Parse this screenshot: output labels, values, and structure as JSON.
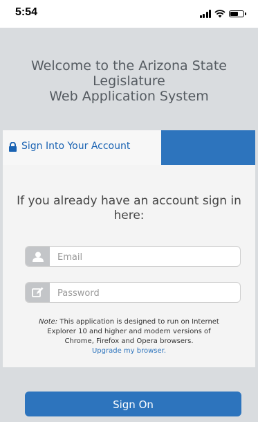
{
  "status_bar": {
    "time": "5:54",
    "battery_level": 0.55
  },
  "welcome": {
    "line1": "Welcome to the Arizona State",
    "line2": "Legislature",
    "line3": "Web Application System"
  },
  "tabs": {
    "active_label": "Sign Into Your Account"
  },
  "form": {
    "prompt_line1": "If you already have an account sign in",
    "prompt_line2": "here:",
    "email": {
      "placeholder": "Email",
      "value": ""
    },
    "password": {
      "placeholder": "Password",
      "value": ""
    }
  },
  "note": {
    "label": "Note:",
    "text_line1": " This application is designed to run on Internet",
    "text_line2": "Explorer 10 and higher and modern versions of",
    "text_line3": "Chrome, Firefox and Opera browsers.",
    "link": "Upgrade my browser."
  },
  "signon_label": "Sign On",
  "colors": {
    "accent": "#2d74bd",
    "background": "#d9dcdf"
  }
}
